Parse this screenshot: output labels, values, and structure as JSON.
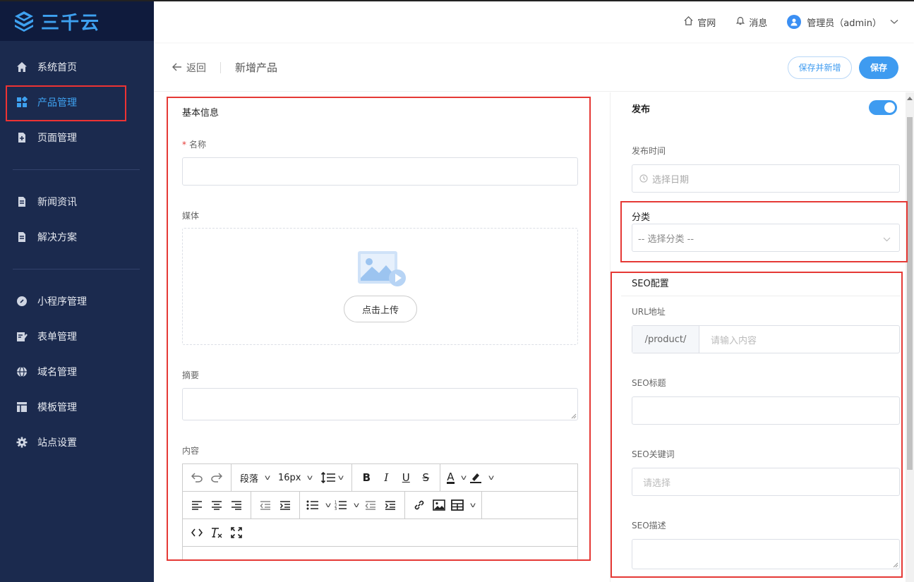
{
  "app": {
    "logo_text": "三千云",
    "brand_color": "#3ea1f0",
    "sidebar_bg": "#1b2a4e",
    "highlight_color": "#e53935"
  },
  "sidebar": {
    "groups": [
      [
        {
          "label": "系统首页",
          "icon": "home-icon"
        },
        {
          "label": "产品管理",
          "icon": "grid-icon",
          "active": true
        },
        {
          "label": "页面管理",
          "icon": "page-add-icon"
        }
      ],
      [
        {
          "label": "新闻资讯",
          "icon": "document-icon"
        },
        {
          "label": "解决方案",
          "icon": "document-icon"
        }
      ],
      [
        {
          "label": "小程序管理",
          "icon": "link-circle-icon"
        },
        {
          "label": "表单管理",
          "icon": "form-edit-icon"
        },
        {
          "label": "域名管理",
          "icon": "globe-icon"
        },
        {
          "label": "模板管理",
          "icon": "template-icon"
        },
        {
          "label": "站点设置",
          "icon": "gear-icon"
        }
      ]
    ]
  },
  "header": {
    "website_label": "官网",
    "messages_label": "消息",
    "user_label": "管理员（admin）"
  },
  "titlebar": {
    "back_label": "返回",
    "page_title": "新增产品",
    "save_and_new_label": "保存并新增",
    "save_label": "保存"
  },
  "basic": {
    "section_title": "基本信息",
    "name_label": "名称",
    "media_label": "媒体",
    "upload_label": "点击上传",
    "summary_label": "摘要",
    "content_label": "内容",
    "paragraph_label": "段落",
    "font_size_label": "16px"
  },
  "publish": {
    "publish_label": "发布",
    "publish_enabled": true,
    "time_label": "发布时间",
    "time_placeholder": "选择日期",
    "category_label": "分类",
    "category_placeholder": "-- 选择分类 --"
  },
  "seo": {
    "section_title": "SEO配置",
    "url_label": "URL地址",
    "url_prefix": "/product/",
    "url_placeholder": "请输入内容",
    "title_label": "SEO标题",
    "keywords_label": "SEO关键词",
    "keywords_placeholder": "请选择",
    "description_label": "SEO描述"
  }
}
